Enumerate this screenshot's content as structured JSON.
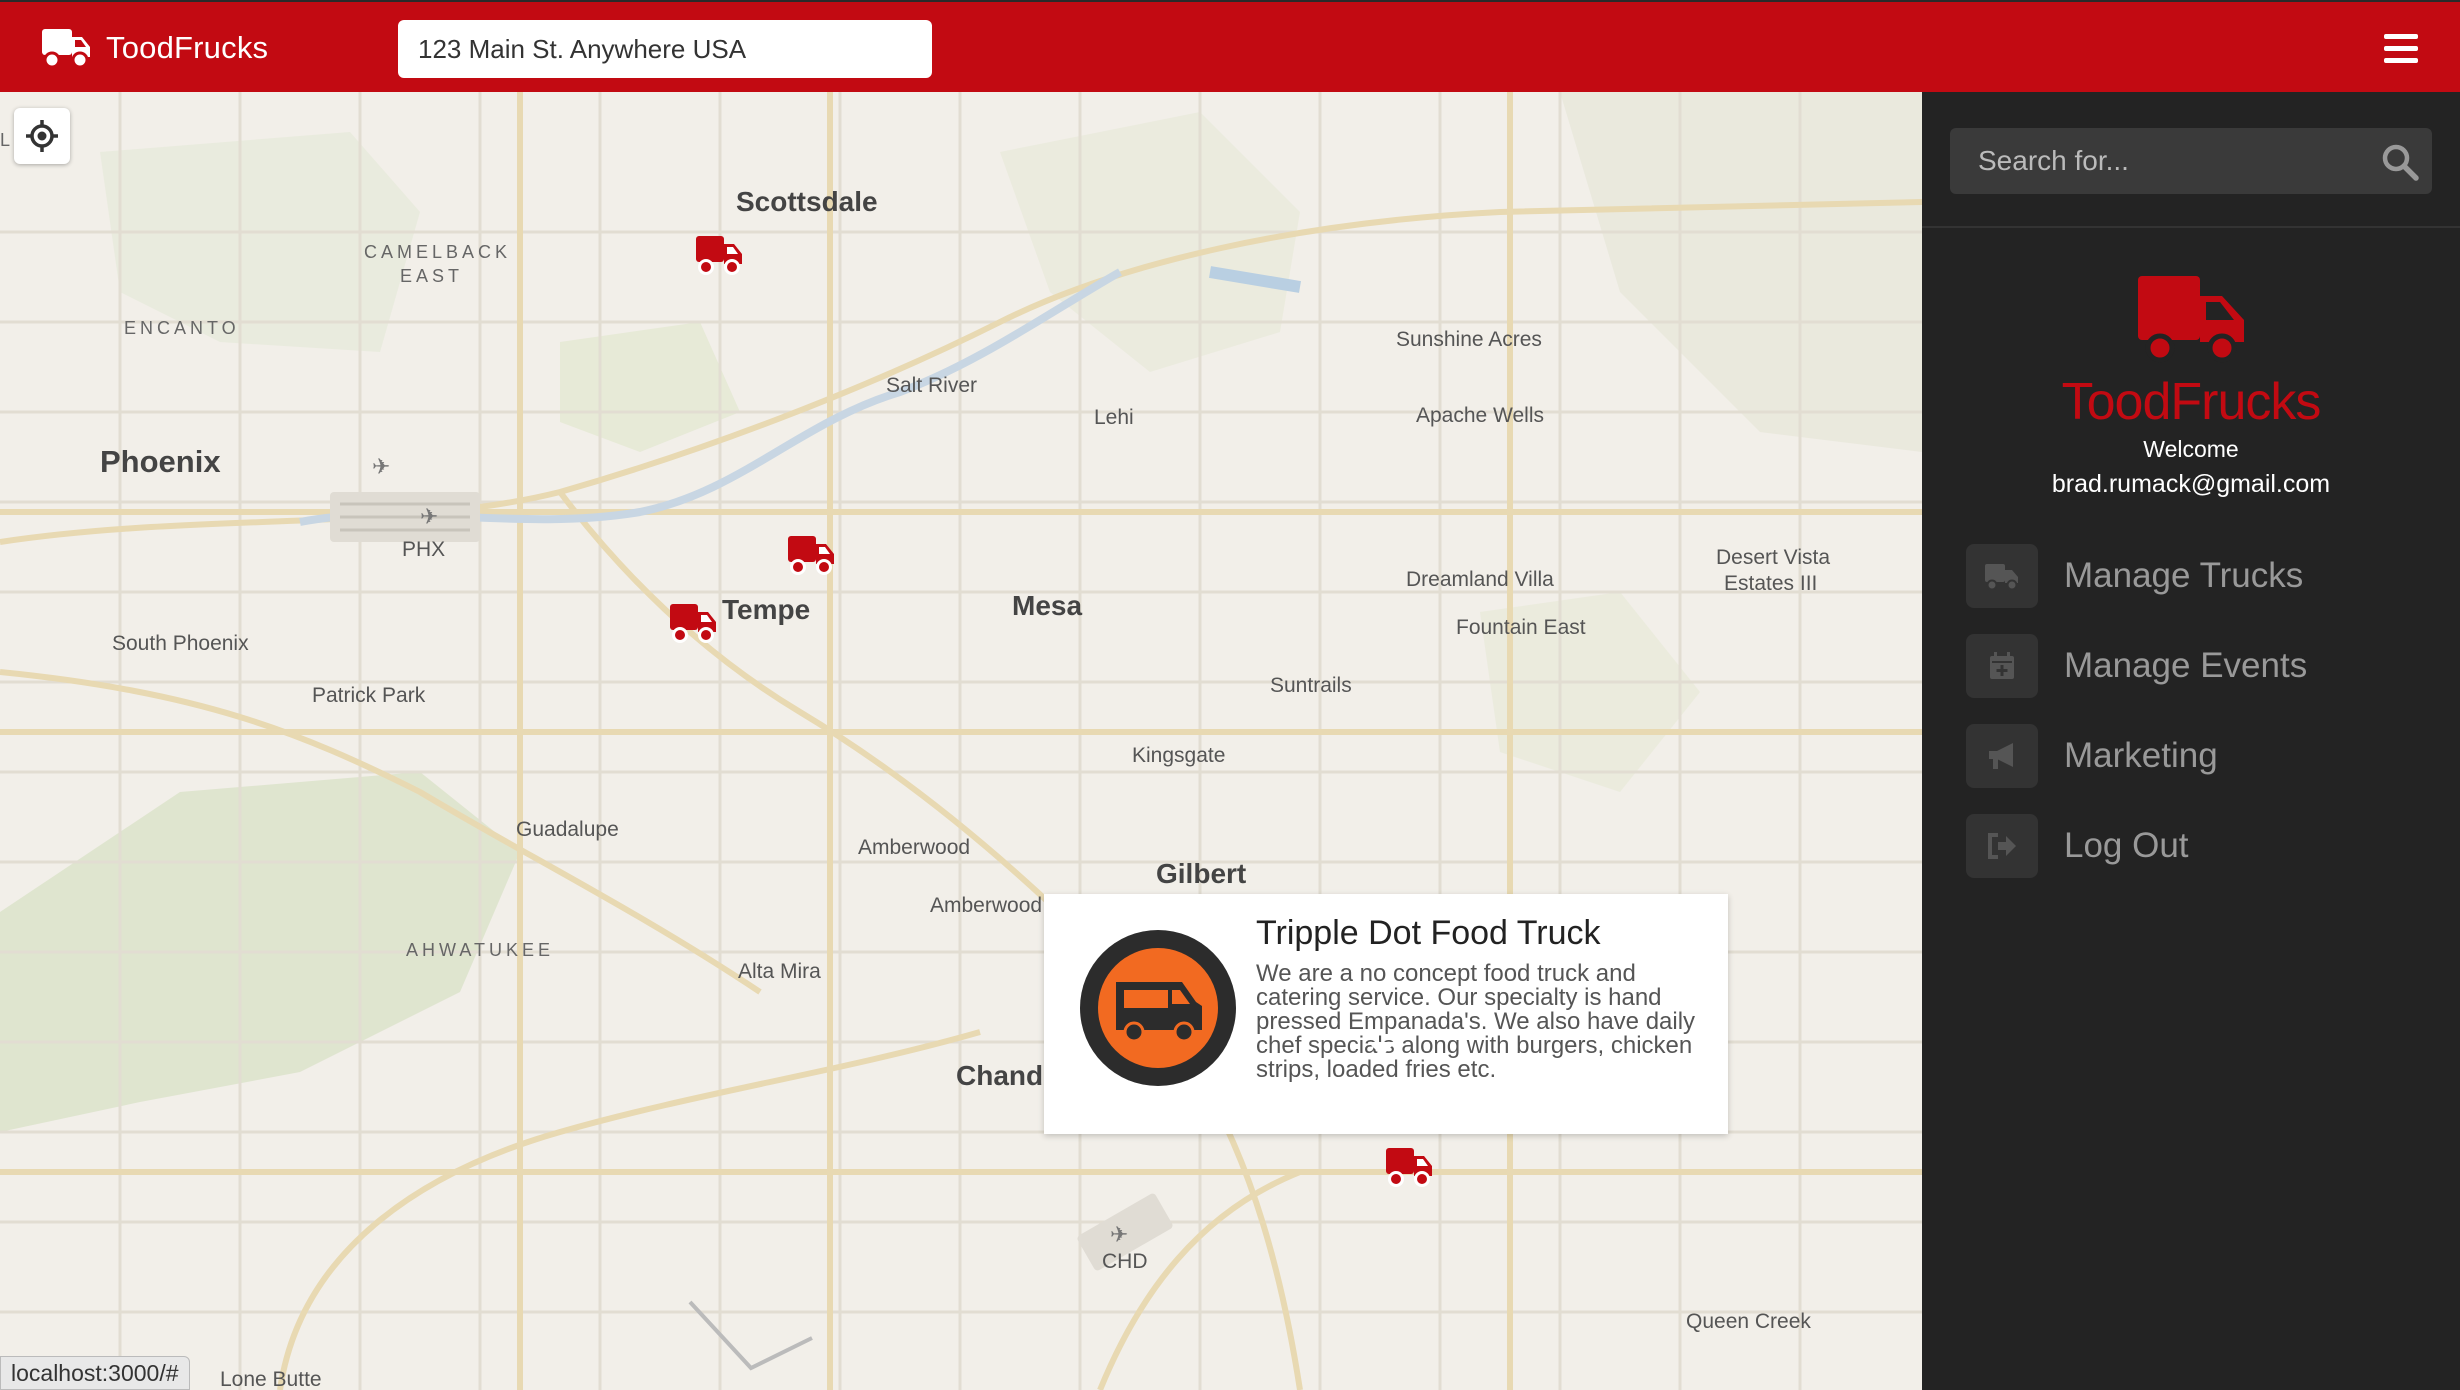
{
  "navbar": {
    "brand": "ToodFrucks",
    "address_value": "123 Main St. Anywhere USA",
    "accent_color": "#c20a12",
    "menu_icon": "hamburger-icon"
  },
  "map": {
    "labels": {
      "scottsdale": "Scottsdale",
      "camelback": "CAMELBACK",
      "camelback_east": "EAST",
      "encanto": "ENCANTO",
      "salt_river": "Salt River",
      "lehi": "Lehi",
      "sunshine_acres": "Sunshine Acres",
      "apache_wells": "Apache Wells",
      "phoenix": "Phoenix",
      "phx": "PHX",
      "desert_vista": "Desert Vista",
      "estates_iii": "Estates III",
      "dreamland_villa": "Dreamland Villa",
      "tempe": "Tempe",
      "mesa": "Mesa",
      "fountain_east": "Fountain East",
      "south_phoenix": "South Phoenix",
      "suntrails": "Suntrails",
      "patrick_park": "Patrick Park",
      "kingsgate": "Kingsgate",
      "guadalupe": "Guadalupe",
      "amberwood": "Amberwood",
      "gilbert": "Gilbert",
      "amberwood_2": "Amberwood",
      "ahwatukee": "AHWATUKEE",
      "alta_mira": "Alta Mira",
      "chandler_partial": "Chandl",
      "chd": "CHD",
      "queen_creek": "Queen Creek",
      "lone_butte": "Lone Butte",
      "corner_partial": "L    RA"
    },
    "popup": {
      "title": "Tripple Dot Food Truck",
      "description": "We are a no concept food truck and catering service. Our specialty is hand pressed Empanada's. We also have daily chef specials along with burgers, chicken strips, loaded fries etc.",
      "logo_icon": "food-truck-logo-icon"
    },
    "status_url": "localhost:3000/#"
  },
  "sidebar": {
    "search_placeholder": "Search for...",
    "brand": "ToodFrucks",
    "welcome": "Welcome",
    "email": "brad.rumack@gmail.com",
    "nav": [
      {
        "label": "Manage Trucks",
        "icon": "truck-icon"
      },
      {
        "label": "Manage Events",
        "icon": "calendar-plus-icon"
      },
      {
        "label": "Marketing",
        "icon": "megaphone-icon"
      },
      {
        "label": "Log Out",
        "icon": "sign-out-icon"
      }
    ]
  }
}
